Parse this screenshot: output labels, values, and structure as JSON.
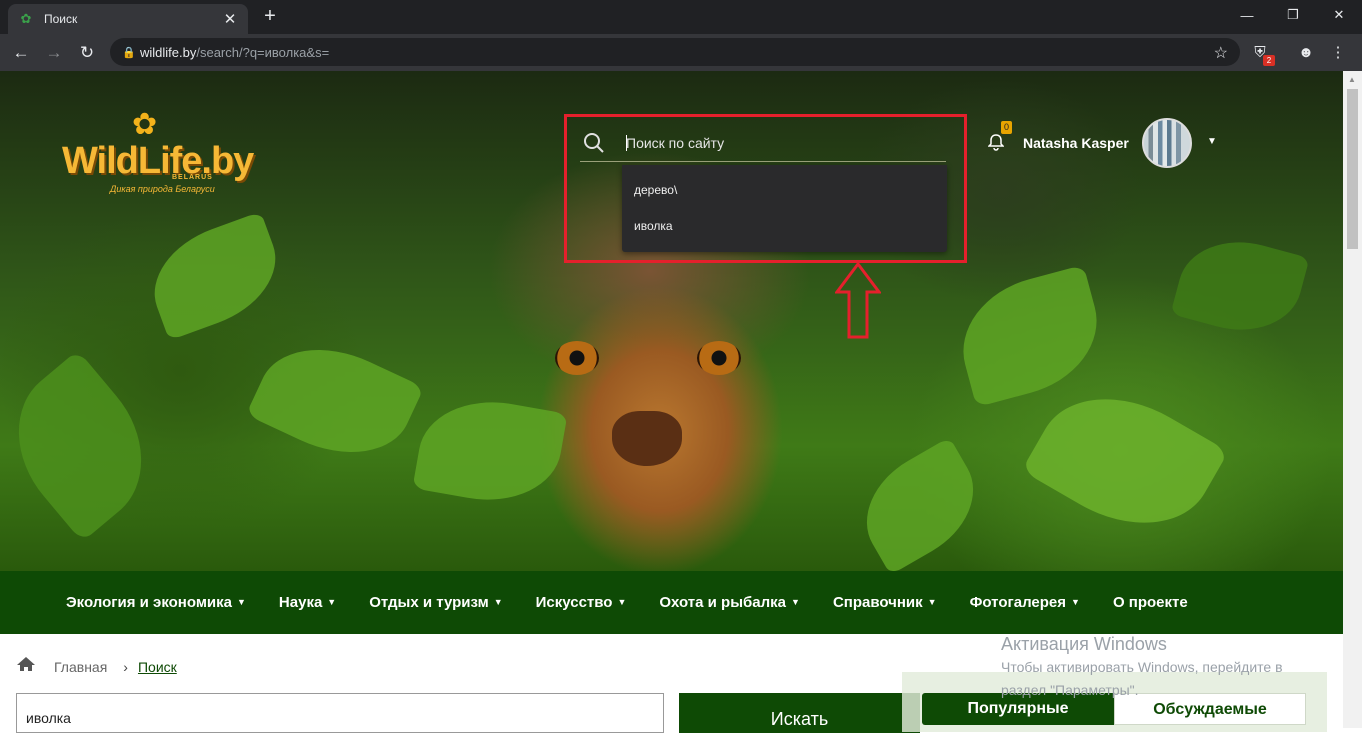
{
  "browser": {
    "tab_title": "Поиск",
    "url_host": "wildlife.by",
    "url_path": "/search/?q=иволка&s=",
    "ext_badge": "2"
  },
  "site": {
    "logo_word": "WildLife.by",
    "logo_country": "BELARUS",
    "logo_tagline": "Дикая природа Беларуси"
  },
  "search": {
    "placeholder": "Поиск по сайту",
    "suggestions": [
      "дерево\\",
      "иволка"
    ]
  },
  "user": {
    "notifications": "0",
    "name": "Natasha Kasper"
  },
  "menu": [
    {
      "label": "Экология и экономика",
      "dropdown": true
    },
    {
      "label": "Наука",
      "dropdown": true
    },
    {
      "label": "Отдых и туризм",
      "dropdown": true
    },
    {
      "label": "Искусство",
      "dropdown": true
    },
    {
      "label": "Охота и рыбалка",
      "dropdown": true
    },
    {
      "label": "Справочник",
      "dropdown": true
    },
    {
      "label": "Фотогалерея",
      "dropdown": true
    },
    {
      "label": "О проекте",
      "dropdown": false
    }
  ],
  "breadcrumb": {
    "home": "Главная",
    "current": "Поиск"
  },
  "results_search": {
    "query": "иволка",
    "button": "Искать"
  },
  "side_tabs": {
    "popular": "Популярные",
    "discussed": "Обсуждаемые"
  },
  "windows_watermark": {
    "title": "Активация Windows",
    "line1": "Чтобы активировать Windows, перейдите в",
    "line2": "раздел \"Параметры\"."
  },
  "colors": {
    "brand_green": "#0e4a05",
    "highlight_red": "#e5202c",
    "logo_gold": "#f6b836"
  }
}
